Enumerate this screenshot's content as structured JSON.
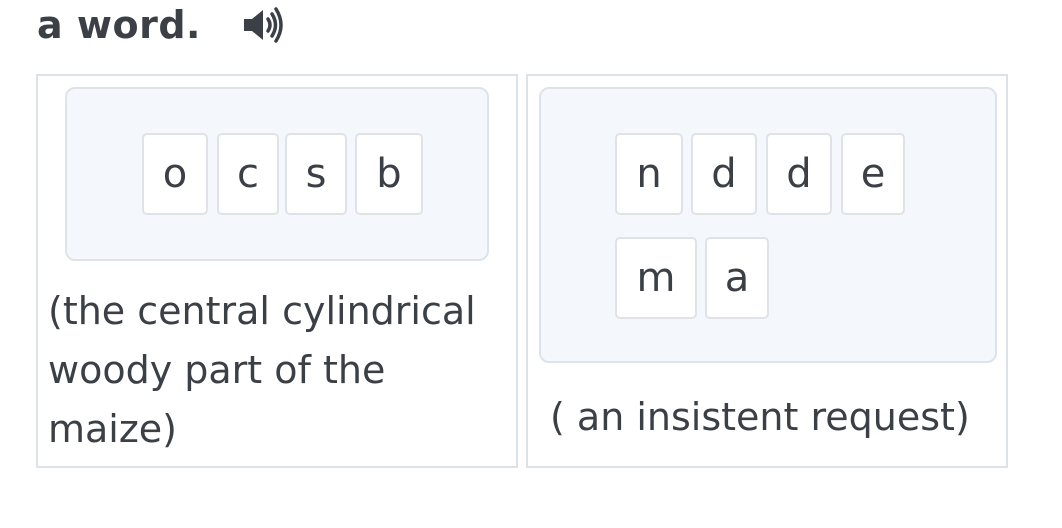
{
  "heading": {
    "text": "a word.",
    "audio_icon": "speaker-icon"
  },
  "cards": [
    {
      "letters": [
        "o",
        "c",
        "s",
        "b"
      ],
      "clue": "(the central cylindrical woody part of the maize)"
    },
    {
      "letters": [
        "n",
        "d",
        "d",
        "e",
        "m",
        "a"
      ],
      "clue": "( an insistent request)"
    }
  ]
}
